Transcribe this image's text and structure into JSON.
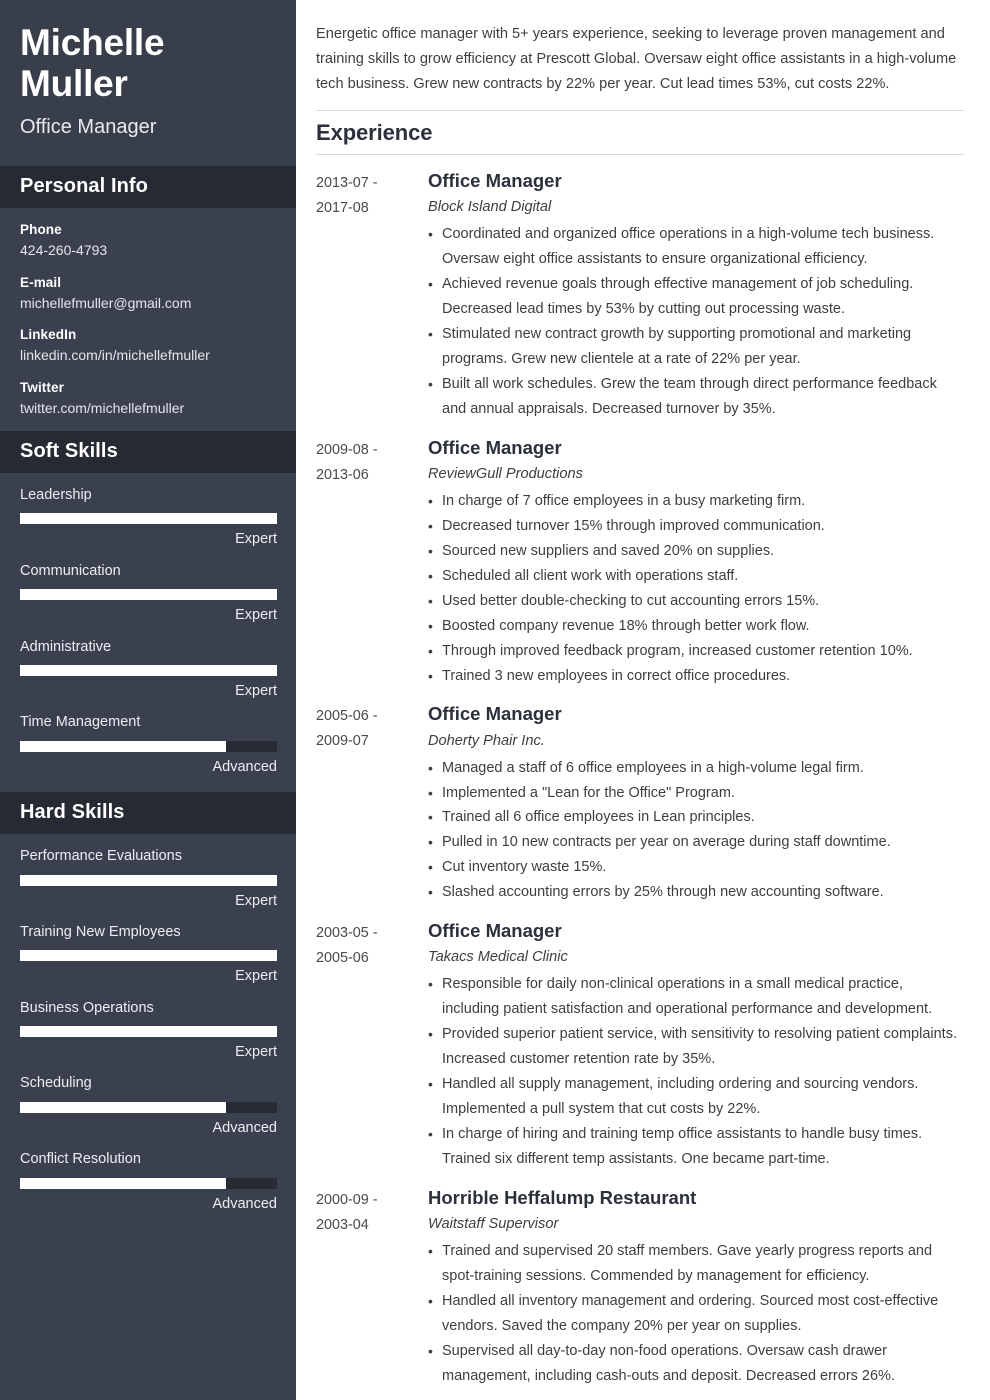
{
  "colors": {
    "sidebar_bg": "#3a404d",
    "sidebar_header_bg": "#383e4a",
    "section_band_bg": "#262a33",
    "skill_track": "#272b34",
    "skill_fill": "#ffffff",
    "main_text": "#3e3e42",
    "heading_text": "#2b303b",
    "rule": "#d8d8d8"
  },
  "sidebar": {
    "full_name": "Michelle Muller",
    "job_role": "Office Manager",
    "personal_info": {
      "heading": "Personal Info",
      "items": [
        {
          "label": "Phone",
          "value": "424-260-4793"
        },
        {
          "label": "E-mail",
          "value": "michellefmuller@gmail.com"
        },
        {
          "label": "LinkedIn",
          "value": "linkedin.com/in/michellefmuller"
        },
        {
          "label": "Twitter",
          "value": "twitter.com/michellefmuller"
        }
      ]
    },
    "soft_skills": {
      "heading": "Soft Skills",
      "items": [
        {
          "name": "Leadership",
          "level": "Expert",
          "percent": 100
        },
        {
          "name": "Communication",
          "level": "Expert",
          "percent": 100
        },
        {
          "name": "Administrative",
          "level": "Expert",
          "percent": 100
        },
        {
          "name": "Time Management",
          "level": "Advanced",
          "percent": 80
        }
      ]
    },
    "hard_skills": {
      "heading": "Hard Skills",
      "items": [
        {
          "name": "Performance Evaluations",
          "level": "Expert",
          "percent": 100
        },
        {
          "name": "Training New Employees",
          "level": "Expert",
          "percent": 100
        },
        {
          "name": "Business Operations",
          "level": "Expert",
          "percent": 100
        },
        {
          "name": "Scheduling",
          "level": "Advanced",
          "percent": 80
        },
        {
          "name": "Conflict Resolution",
          "level": "Advanced",
          "percent": 80
        }
      ]
    }
  },
  "main": {
    "summary": "Energetic office manager with 5+ years experience, seeking to leverage proven management and training skills to grow efficiency at Prescott Global. Oversaw eight office assistants in a high-volume tech business. Grew new contracts by 22% per year. Cut lead times 53%, cut costs 22%.",
    "experience_heading": "Experience",
    "jobs": [
      {
        "date_start": "2013-07 -",
        "date_end": "2017-08",
        "title": "Office Manager",
        "company": "Block Island Digital",
        "bullets": [
          "Coordinated and organized office operations in a high-volume tech business. Oversaw eight office assistants to ensure organizational efficiency.",
          "Achieved revenue goals through effective management of job scheduling. Decreased lead times by 53% by cutting out processing waste.",
          "Stimulated new contract growth by supporting promotional and marketing programs. Grew new clientele at a rate of 22% per year.",
          "Built all work schedules. Grew the team through direct performance feedback and annual appraisals. Decreased turnover by 35%."
        ]
      },
      {
        "date_start": "2009-08 -",
        "date_end": "2013-06",
        "title": "Office Manager",
        "company": "ReviewGull Productions",
        "bullets": [
          "In charge of 7 office employees in a busy marketing firm.",
          "Decreased turnover 15% through improved communication.",
          "Sourced new suppliers and saved 20% on supplies.",
          "Scheduled all client work with operations staff.",
          "Used better double-checking to cut accounting errors 15%.",
          "Boosted company revenue 18% through better work flow.",
          "Through improved feedback program, increased customer retention 10%.",
          "Trained 3 new employees in correct office procedures."
        ]
      },
      {
        "date_start": "2005-06 -",
        "date_end": "2009-07",
        "title": "Office Manager",
        "company": "Doherty Phair Inc.",
        "bullets": [
          "Managed a staff of 6 office employees in a high-volume legal firm.",
          "Implemented a \"Lean for the Office\" Program.",
          "Trained all 6 office employees in Lean principles.",
          "Pulled in 10 new contracts per year on average during staff downtime.",
          "Cut inventory waste 15%.",
          "Slashed accounting errors by 25% through new accounting software."
        ]
      },
      {
        "date_start": "2003-05 -",
        "date_end": "2005-06",
        "title": "Office Manager",
        "company": "Takacs Medical Clinic",
        "bullets": [
          "Responsible for daily non-clinical operations in a small medical practice, including patient satisfaction and operational performance and development.",
          "Provided superior patient service, with sensitivity to resolving patient complaints. Increased customer retention rate by 35%.",
          "Handled all supply management, including ordering and sourcing vendors. Implemented a pull system that cut costs by 22%.",
          "In charge of hiring and training temp office assistants to handle busy times. Trained six different temp assistants. One became part-time."
        ]
      },
      {
        "date_start": "2000-09 -",
        "date_end": "2003-04",
        "title": "Horrible Heffalump Restaurant",
        "company": "Waitstaff Supervisor",
        "bullets": [
          "Trained and supervised 20 staff members. Gave yearly progress reports and spot-training sessions. Commended by management for efficiency.",
          "Handled all inventory management and ordering. Sourced most cost-effective vendors. Saved the company 20% per year on supplies.",
          "Supervised all day-to-day non-food operations. Oversaw cash drawer management, including cash-outs and deposit. Decreased errors 26%."
        ]
      }
    ]
  }
}
